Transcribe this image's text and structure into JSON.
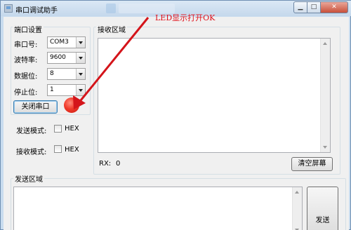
{
  "window": {
    "title": "串口调试助手",
    "minimize_glyph": "▁",
    "maximize_glyph": "□",
    "close_glyph": "✕"
  },
  "port_settings": {
    "group_title": "端口设置",
    "port_label": "串口号:",
    "port_value": "COM3",
    "baud_label": "波特率:",
    "baud_value": "9600",
    "databits_label": "数据位:",
    "databits_value": "8",
    "stopbits_label": "停止位:",
    "stopbits_value": "1",
    "close_port_button": "关闭串口",
    "led_color": "#f03a2a"
  },
  "send_mode": {
    "label": "发送模式:",
    "hex_label": "HEX",
    "hex_checked": false
  },
  "receive_mode": {
    "label": "接收模式:",
    "hex_label": "HEX",
    "hex_checked": false
  },
  "receive_area": {
    "group_title": "接收区域",
    "content": "",
    "rx_label": "RX:",
    "rx_count": "0",
    "clear_button": "清空屏幕"
  },
  "send_area": {
    "group_title": "发送区域",
    "content": "",
    "send_button": "发送"
  },
  "annotation": {
    "text": "LED显示打开OK",
    "color": "#e0101a"
  },
  "colors": {
    "titlebar": "#c9dcef",
    "client_bg": "#f0f0f0",
    "close_button": "#c8503a"
  }
}
